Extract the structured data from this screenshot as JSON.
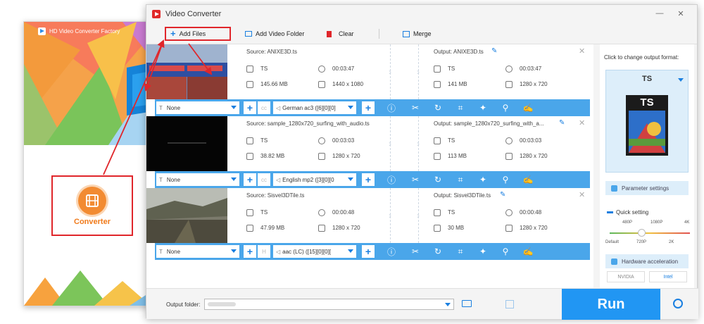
{
  "launcher": {
    "title": "HD Video Converter Factory",
    "converter_label": "Converter"
  },
  "window": {
    "title": "Video Converter",
    "minimize": "—",
    "close": "✕"
  },
  "toolbar": {
    "add_files": "Add Files",
    "add_folder": "Add Video Folder",
    "clear": "Clear",
    "merge": "Merge"
  },
  "files": [
    {
      "source": "Source: ANIXE3D.ts",
      "src_format": "TS",
      "src_duration": "00:03:47",
      "src_size": "145.66 MB",
      "src_res": "1440 x 1080",
      "output": "Output: ANIXE3D.ts",
      "out_format": "TS",
      "out_duration": "00:03:47",
      "out_size": "141 MB",
      "out_res": "1280 x 720",
      "subtitle": "None",
      "audio": "German ac3 ([6][0][0]"
    },
    {
      "source": "Source: sample_1280x720_surfing_with_audio.ts",
      "src_format": "TS",
      "src_duration": "00:03:03",
      "src_size": "38.82 MB",
      "src_res": "1280 x 720",
      "output": "Output: sample_1280x720_surfing_with_a...",
      "out_format": "TS",
      "out_duration": "00:03:03",
      "out_size": "113 MB",
      "out_res": "1280 x 720",
      "subtitle": "None",
      "audio": "English mp2 ([3][0][0"
    },
    {
      "source": "Source: Sisvel3DTile.ts",
      "src_format": "TS",
      "src_duration": "00:00:48",
      "src_size": "47.99 MB",
      "src_res": "1280 x 720",
      "output": "Output: Sisvel3DTile.ts",
      "out_format": "TS",
      "out_duration": "00:00:48",
      "out_size": "30 MB",
      "out_res": "1280 x 720",
      "subtitle": "None",
      "audio": "aac (LC) ([15][0][0]["
    }
  ],
  "right_panel": {
    "hint": "Click to change output format:",
    "format": "TS",
    "format_icon_text": "TS",
    "param_settings": "Parameter settings",
    "quick_setting": "Quick setting",
    "ticks_top": [
      "480P",
      "1080P",
      "4K"
    ],
    "ticks_bottom": [
      "Default",
      "720P",
      "2K"
    ],
    "hw_accel": "Hardware acceleration",
    "vendor_nvidia": "NVIDIA",
    "vendor_intel": "Intel"
  },
  "bottom": {
    "output_folder_label": "Output folder:",
    "run": "Run"
  },
  "colors": {
    "accent": "#2196f3",
    "action_bar": "#4aa6ea",
    "highlight_red": "#e0262b",
    "converter_orange": "#f28b32"
  }
}
